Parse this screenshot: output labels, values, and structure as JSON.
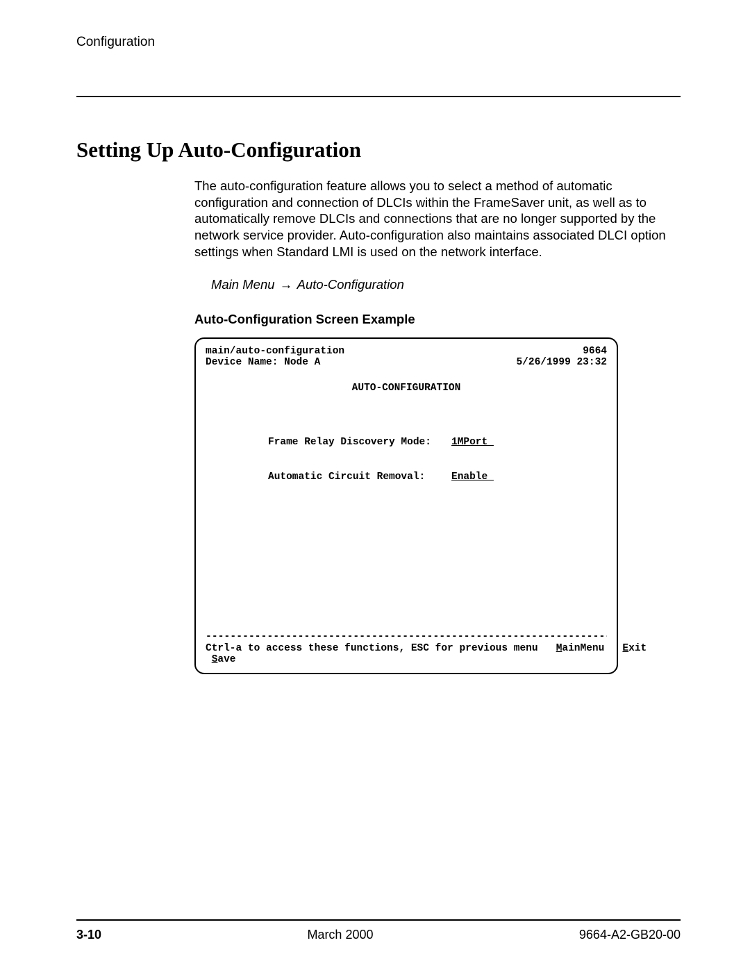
{
  "header": {
    "running": "Configuration"
  },
  "title": "Setting Up Auto-Configuration",
  "body": {
    "para1": "The auto-configuration feature allows you to select a method of automatic configuration and connection of DLCIs within the FrameSaver unit, as well as to automatically remove DLCIs and connections that are no longer supported by the network service provider. Auto-configuration also maintains associated DLCI option settings when Standard LMI is used on the network interface.",
    "nav_left": "Main Menu",
    "nav_right": "Auto-Configuration",
    "example_caption": "Auto-Configuration Screen Example"
  },
  "terminal": {
    "path": "main/auto-configuration",
    "model": "9664",
    "device_label": "Device Name:",
    "device_name": "Node A",
    "datetime": "5/26/1999 23:32",
    "screen_title": "AUTO-CONFIGURATION",
    "fields": [
      {
        "label": "Frame Relay Discovery Mode:",
        "value": "1MPort "
      },
      {
        "label": "Automatic Circuit Removal:",
        "value": "Enable "
      }
    ],
    "dashes": "-------------------------------------------------------------------------------",
    "hint": "Ctrl-a to access these functions, ESC for previous menu",
    "menu1_u": "M",
    "menu1_rest": "ainMenu",
    "menu2_u": "E",
    "menu2_rest": "xit",
    "save_u": "S",
    "save_rest": "ave"
  },
  "footer": {
    "pagenum": "3-10",
    "center": "March 2000",
    "right": "9664-A2-GB20-00"
  }
}
